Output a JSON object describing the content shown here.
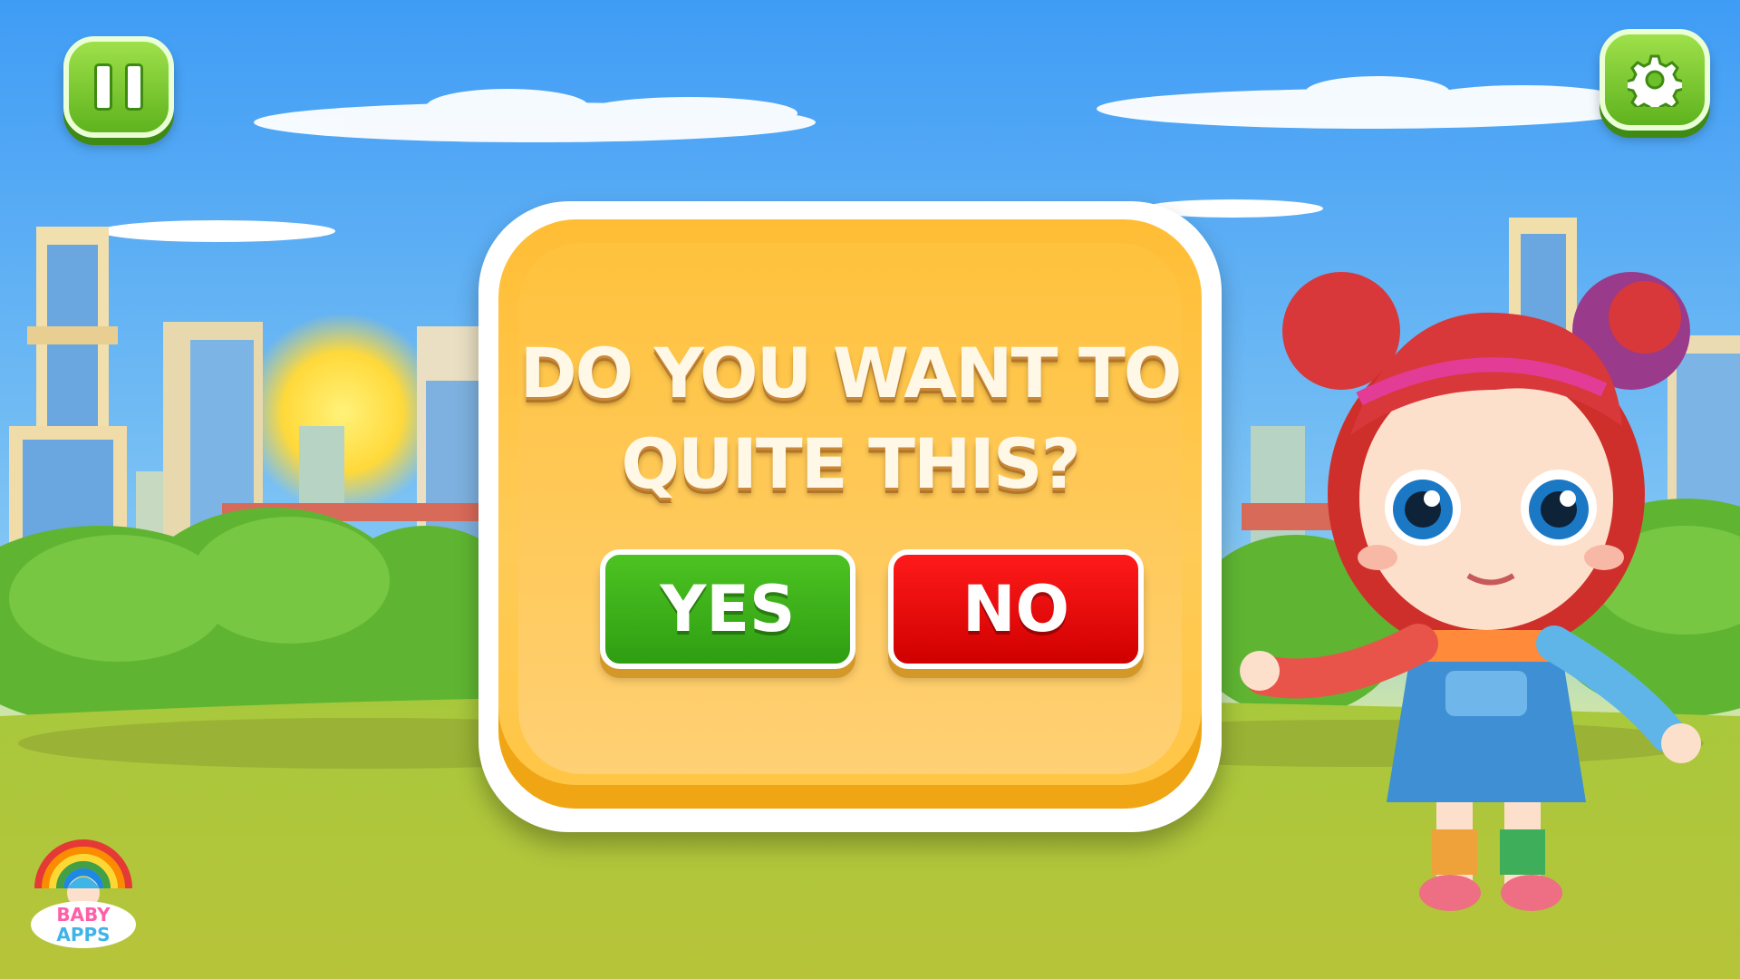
{
  "dialog": {
    "question_line1": "DO YOU WANT TO",
    "question_line2": "QUITE THIS?",
    "yes_label": "YES",
    "no_label": "NO"
  },
  "controls": {
    "pause_icon": "pause-icon",
    "settings_icon": "gear-icon"
  },
  "logo": {
    "line1": "BABY",
    "line2": "APPS"
  },
  "colors": {
    "sky_top": "#4aa9ff",
    "grass": "#a9c23a",
    "dialog": "#ffc13b",
    "yes_button": "#3bb21a",
    "no_button": "#e60000",
    "control_button": "#7fd032"
  }
}
